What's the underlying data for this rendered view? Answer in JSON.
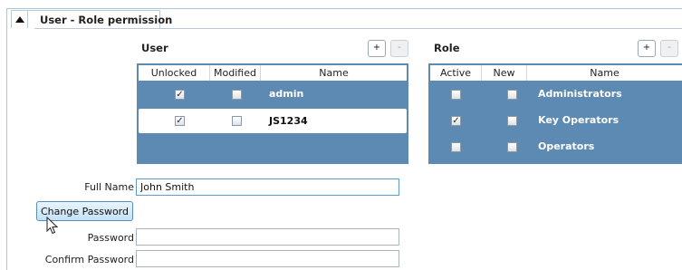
{
  "section": {
    "title": "User - Role permission"
  },
  "user_panel": {
    "title": "User",
    "add_label": "+",
    "remove_label": "-",
    "columns": [
      "Unlocked",
      "Modified",
      "Name"
    ],
    "rows": [
      {
        "unlocked": true,
        "modified": false,
        "name": "admin",
        "selected": false
      },
      {
        "unlocked": true,
        "modified": false,
        "name": "JS1234",
        "selected": true
      }
    ]
  },
  "role_panel": {
    "title": "Role",
    "add_label": "+",
    "remove_label": "-",
    "columns": [
      "Active",
      "New",
      "Name"
    ],
    "rows": [
      {
        "active": false,
        "new": false,
        "name": "Administrators"
      },
      {
        "active": true,
        "new": false,
        "name": "Key Operators"
      },
      {
        "active": false,
        "new": false,
        "name": "Operators"
      }
    ]
  },
  "form": {
    "full_name_label": "Full Name",
    "full_name_value": "John Smith",
    "change_password_label": "Change Password",
    "password_label": "Password",
    "password_value": "",
    "confirm_password_label": "Confirm Password",
    "confirm_password_value": ""
  },
  "icons": {
    "collapse": "collapse-triangle-icon",
    "cursor": "mouse-pointer-icon"
  },
  "colors": {
    "grid_background": "#5d8ab3",
    "button_accent": "#c4e2f6"
  }
}
